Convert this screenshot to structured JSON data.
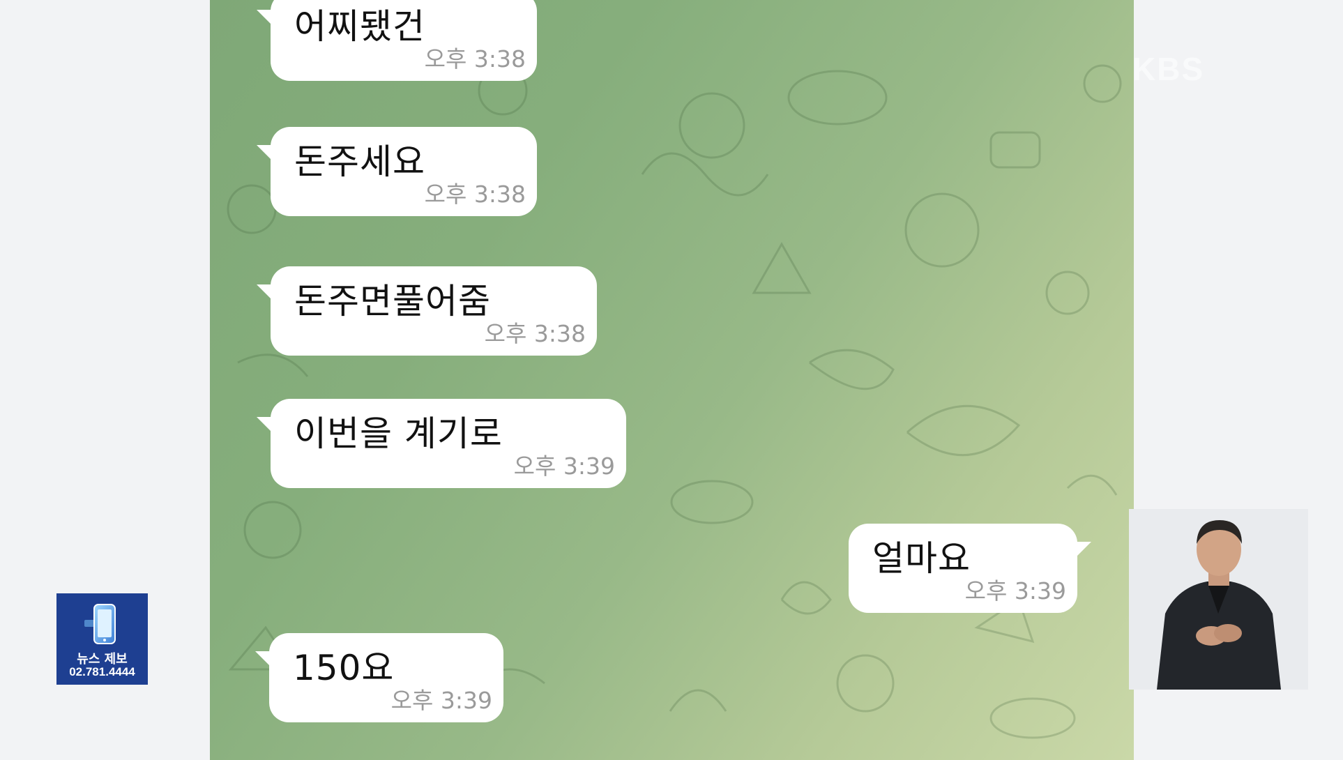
{
  "watermark": {
    "text": "KBS"
  },
  "messages": [
    {
      "direction": "incoming",
      "text": "어찌됐건",
      "time": "오후 3:38"
    },
    {
      "direction": "incoming",
      "text": "돈주세요",
      "time": "오후 3:38"
    },
    {
      "direction": "incoming",
      "text": "돈주면풀어줌",
      "time": "오후 3:38"
    },
    {
      "direction": "incoming",
      "text": "이번을 계기로",
      "time": "오후 3:39"
    },
    {
      "direction": "outgoing",
      "text": "얼마요",
      "time": "오후 3:39"
    },
    {
      "direction": "incoming",
      "text": "150요",
      "time": "오후 3:39"
    }
  ],
  "tip_badge": {
    "label": "뉴스 제보",
    "number": "02.781.4444",
    "icon": "smartphone-icon",
    "color": "#1e3f91"
  },
  "interpreter": {
    "icon": "sign-language-interpreter"
  }
}
